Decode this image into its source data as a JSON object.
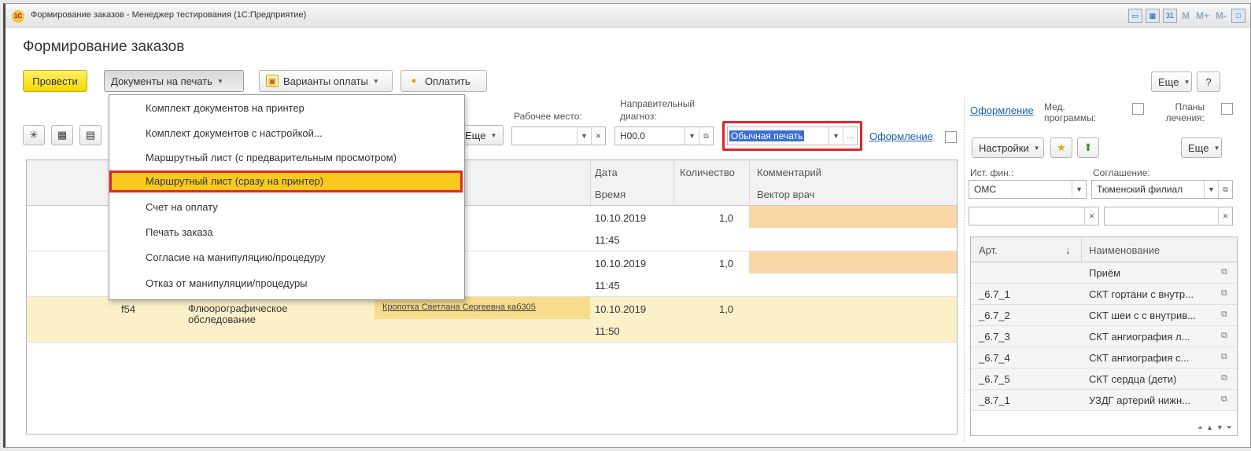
{
  "window": {
    "title": "Формирование заказов - Менеджер тестирования (1С:Предприятие)",
    "logo": "1С",
    "title_icons": [
      "calendar-icon",
      "calc-icon",
      "date-icon",
      "M",
      "M+",
      "M-",
      "window-icon"
    ]
  },
  "form": {
    "title": "Формирование заказов"
  },
  "toolbar": {
    "post": "Провести",
    "print_docs": "Документы на печать",
    "payment_options": "Варианты оплаты",
    "pay": "Оплатить",
    "more": "Еще",
    "help": "?"
  },
  "print_menu": {
    "items": [
      "Комплект документов на принтер",
      "Комплект документов с настройкой...",
      "Маршрутный лист (с предварительным просмотром)",
      "Маршрутный лист (сразу на принтер)",
      "Счет на оплату",
      "Печать заказа",
      "Согласие на манипуляцию/процедуру",
      "Отказ от манипуляции/процедуры"
    ],
    "selected_index": 3
  },
  "filters": {
    "more": "Еще",
    "workplace_label": "Рабочее место:",
    "workplace_value": "",
    "diagnosis_label_1": "Направительный",
    "diagnosis_label_2": "диагноз:",
    "diagnosis_value": "Н00.0",
    "print_mode_value": "Обычная печать",
    "design_link": "Оформление"
  },
  "grid": {
    "headers": {
      "date": "Дата",
      "time": "Время",
      "quantity": "Количество",
      "comment": "Комментарий",
      "doctor": "Вектор врач"
    },
    "rows": [
      {
        "code": "",
        "name": "",
        "doctor": "",
        "date": "10.10.2019",
        "time": "11:45",
        "qty": "1,0"
      },
      {
        "code": "",
        "name": "",
        "doctor": "",
        "date": "10.10.2019",
        "time": "11:45",
        "qty": "1,0"
      },
      {
        "code": "f54",
        "name": "Флюорографическое обследование",
        "doctor": "Кропотка Светлана Сергеевна каб305",
        "date": "10.10.2019",
        "time": "11:50",
        "qty": "1,0"
      }
    ]
  },
  "right_panel": {
    "design_link": "Оформление",
    "med_programs": "Мед. программы:",
    "treatment_plans": "Планы лечения:",
    "settings": "Настройки",
    "more": "Еще",
    "fin_source_label": "Ист. фин.:",
    "fin_source_value": "ОМС",
    "agreement_label": "Соглашение:",
    "agreement_value": "Тюменский филиал",
    "table": {
      "col_art": "Арт.",
      "sort_arrow": "↓",
      "col_name": "Наименование",
      "rows": [
        {
          "art": "",
          "name": "Приём"
        },
        {
          "art": "_6.7_1",
          "name": "СКТ гортани с внутр..."
        },
        {
          "art": "_6.7_2",
          "name": "СКТ шеи с с внутрив..."
        },
        {
          "art": "_6.7_3",
          "name": "СКТ ангиография л..."
        },
        {
          "art": "_6.7_4",
          "name": "СКТ ангиография с..."
        },
        {
          "art": "_6.7_5",
          "name": "СКТ сердца (дети)"
        },
        {
          "art": "_8.7_1",
          "name": "УЗДГ артерий нижн..."
        }
      ]
    }
  },
  "colors": {
    "accent_yellow": "#f4d800",
    "highlight_red": "#e0262a",
    "link_blue": "#1c5fb0",
    "row_orange": "#fbd7a8"
  }
}
